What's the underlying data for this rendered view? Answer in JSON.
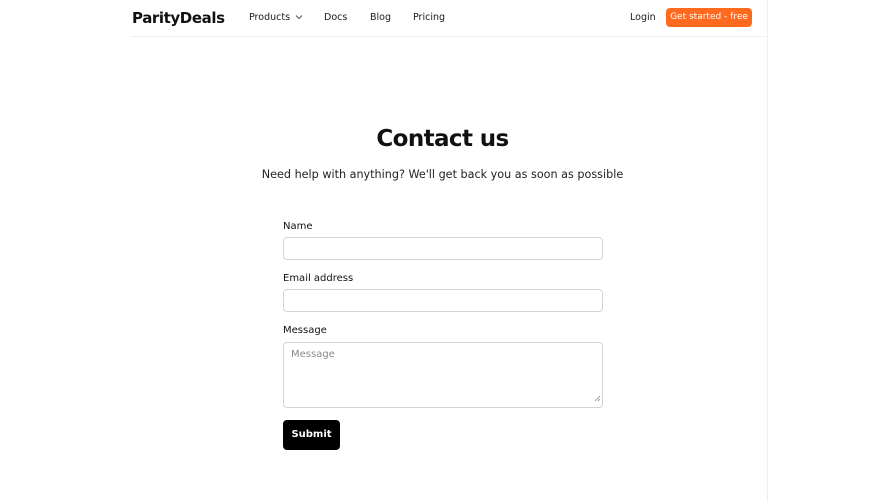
{
  "header": {
    "logo": "ParityDeals",
    "nav": {
      "products": "Products",
      "docs": "Docs",
      "blog": "Blog",
      "pricing": "Pricing"
    },
    "login": "Login",
    "cta": "Get started - free"
  },
  "main": {
    "title": "Contact us",
    "subtitle": "Need help with anything? We'll get back you as soon as possible"
  },
  "form": {
    "name_label": "Name",
    "name_value": "",
    "email_label": "Email address",
    "email_value": "",
    "message_label": "Message",
    "message_placeholder": "Message",
    "submit": "Submit"
  },
  "colors": {
    "cta": "#ff6a1f",
    "submit": "#000000"
  }
}
